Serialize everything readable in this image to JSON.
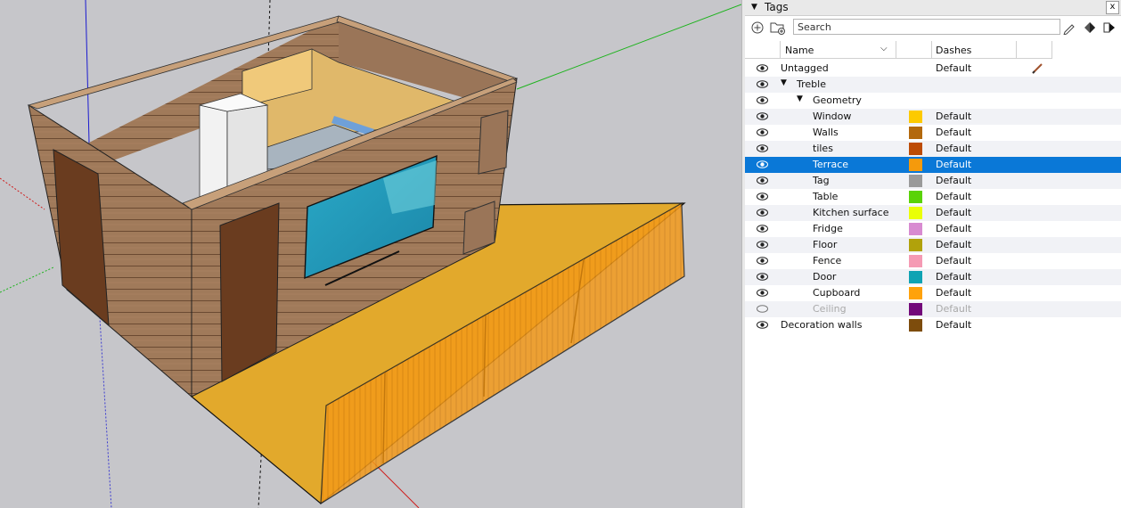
{
  "panel": {
    "title": "Tags",
    "close_label": "x",
    "search_placeholder": "Search",
    "columns": {
      "name": "Name",
      "dashes": "Dashes"
    }
  },
  "rows": [
    {
      "name": "Untagged",
      "level": 0,
      "visible": true,
      "color": null,
      "dashes": "Default",
      "twist": "",
      "pencil": true
    },
    {
      "name": "Treble",
      "level": 0,
      "visible": true,
      "color": null,
      "dashes": "",
      "twist": "▼"
    },
    {
      "name": "Geometry",
      "level": 1,
      "visible": true,
      "color": null,
      "dashes": "",
      "twist": "▼"
    },
    {
      "name": "Window",
      "level": 2,
      "visible": true,
      "color": "#fdca00",
      "dashes": "Default"
    },
    {
      "name": "Walls",
      "level": 2,
      "visible": true,
      "color": "#b3690d",
      "dashes": "Default"
    },
    {
      "name": "tiles",
      "level": 2,
      "visible": true,
      "color": "#bd4c05",
      "dashes": "Default"
    },
    {
      "name": "Terrace",
      "level": 2,
      "visible": true,
      "color": "#f59a0c",
      "dashes": "Default",
      "selected": true
    },
    {
      "name": "Tag",
      "level": 2,
      "visible": true,
      "color": "#9a9a9a",
      "dashes": "Default"
    },
    {
      "name": "Table",
      "level": 2,
      "visible": true,
      "color": "#5ad307",
      "dashes": "Default"
    },
    {
      "name": "Kitchen surface",
      "level": 2,
      "visible": true,
      "color": "#eaff06",
      "dashes": "Default"
    },
    {
      "name": "Fridge",
      "level": 2,
      "visible": true,
      "color": "#d88bd1",
      "dashes": "Default"
    },
    {
      "name": "Floor",
      "level": 2,
      "visible": true,
      "color": "#b1a20b",
      "dashes": "Default"
    },
    {
      "name": "Fence",
      "level": 2,
      "visible": true,
      "color": "#f59ab4",
      "dashes": "Default"
    },
    {
      "name": "Door",
      "level": 2,
      "visible": true,
      "color": "#0fa3b3",
      "dashes": "Default"
    },
    {
      "name": "Cupboard",
      "level": 2,
      "visible": true,
      "color": "#ffa20a",
      "dashes": "Default"
    },
    {
      "name": "Ceiling",
      "level": 2,
      "visible": false,
      "color": "#73097a",
      "dashes": "Default"
    },
    {
      "name": "Decoration walls",
      "level": 0,
      "visible": true,
      "color": "#7d4c0c",
      "dashes": "Default"
    }
  ]
}
